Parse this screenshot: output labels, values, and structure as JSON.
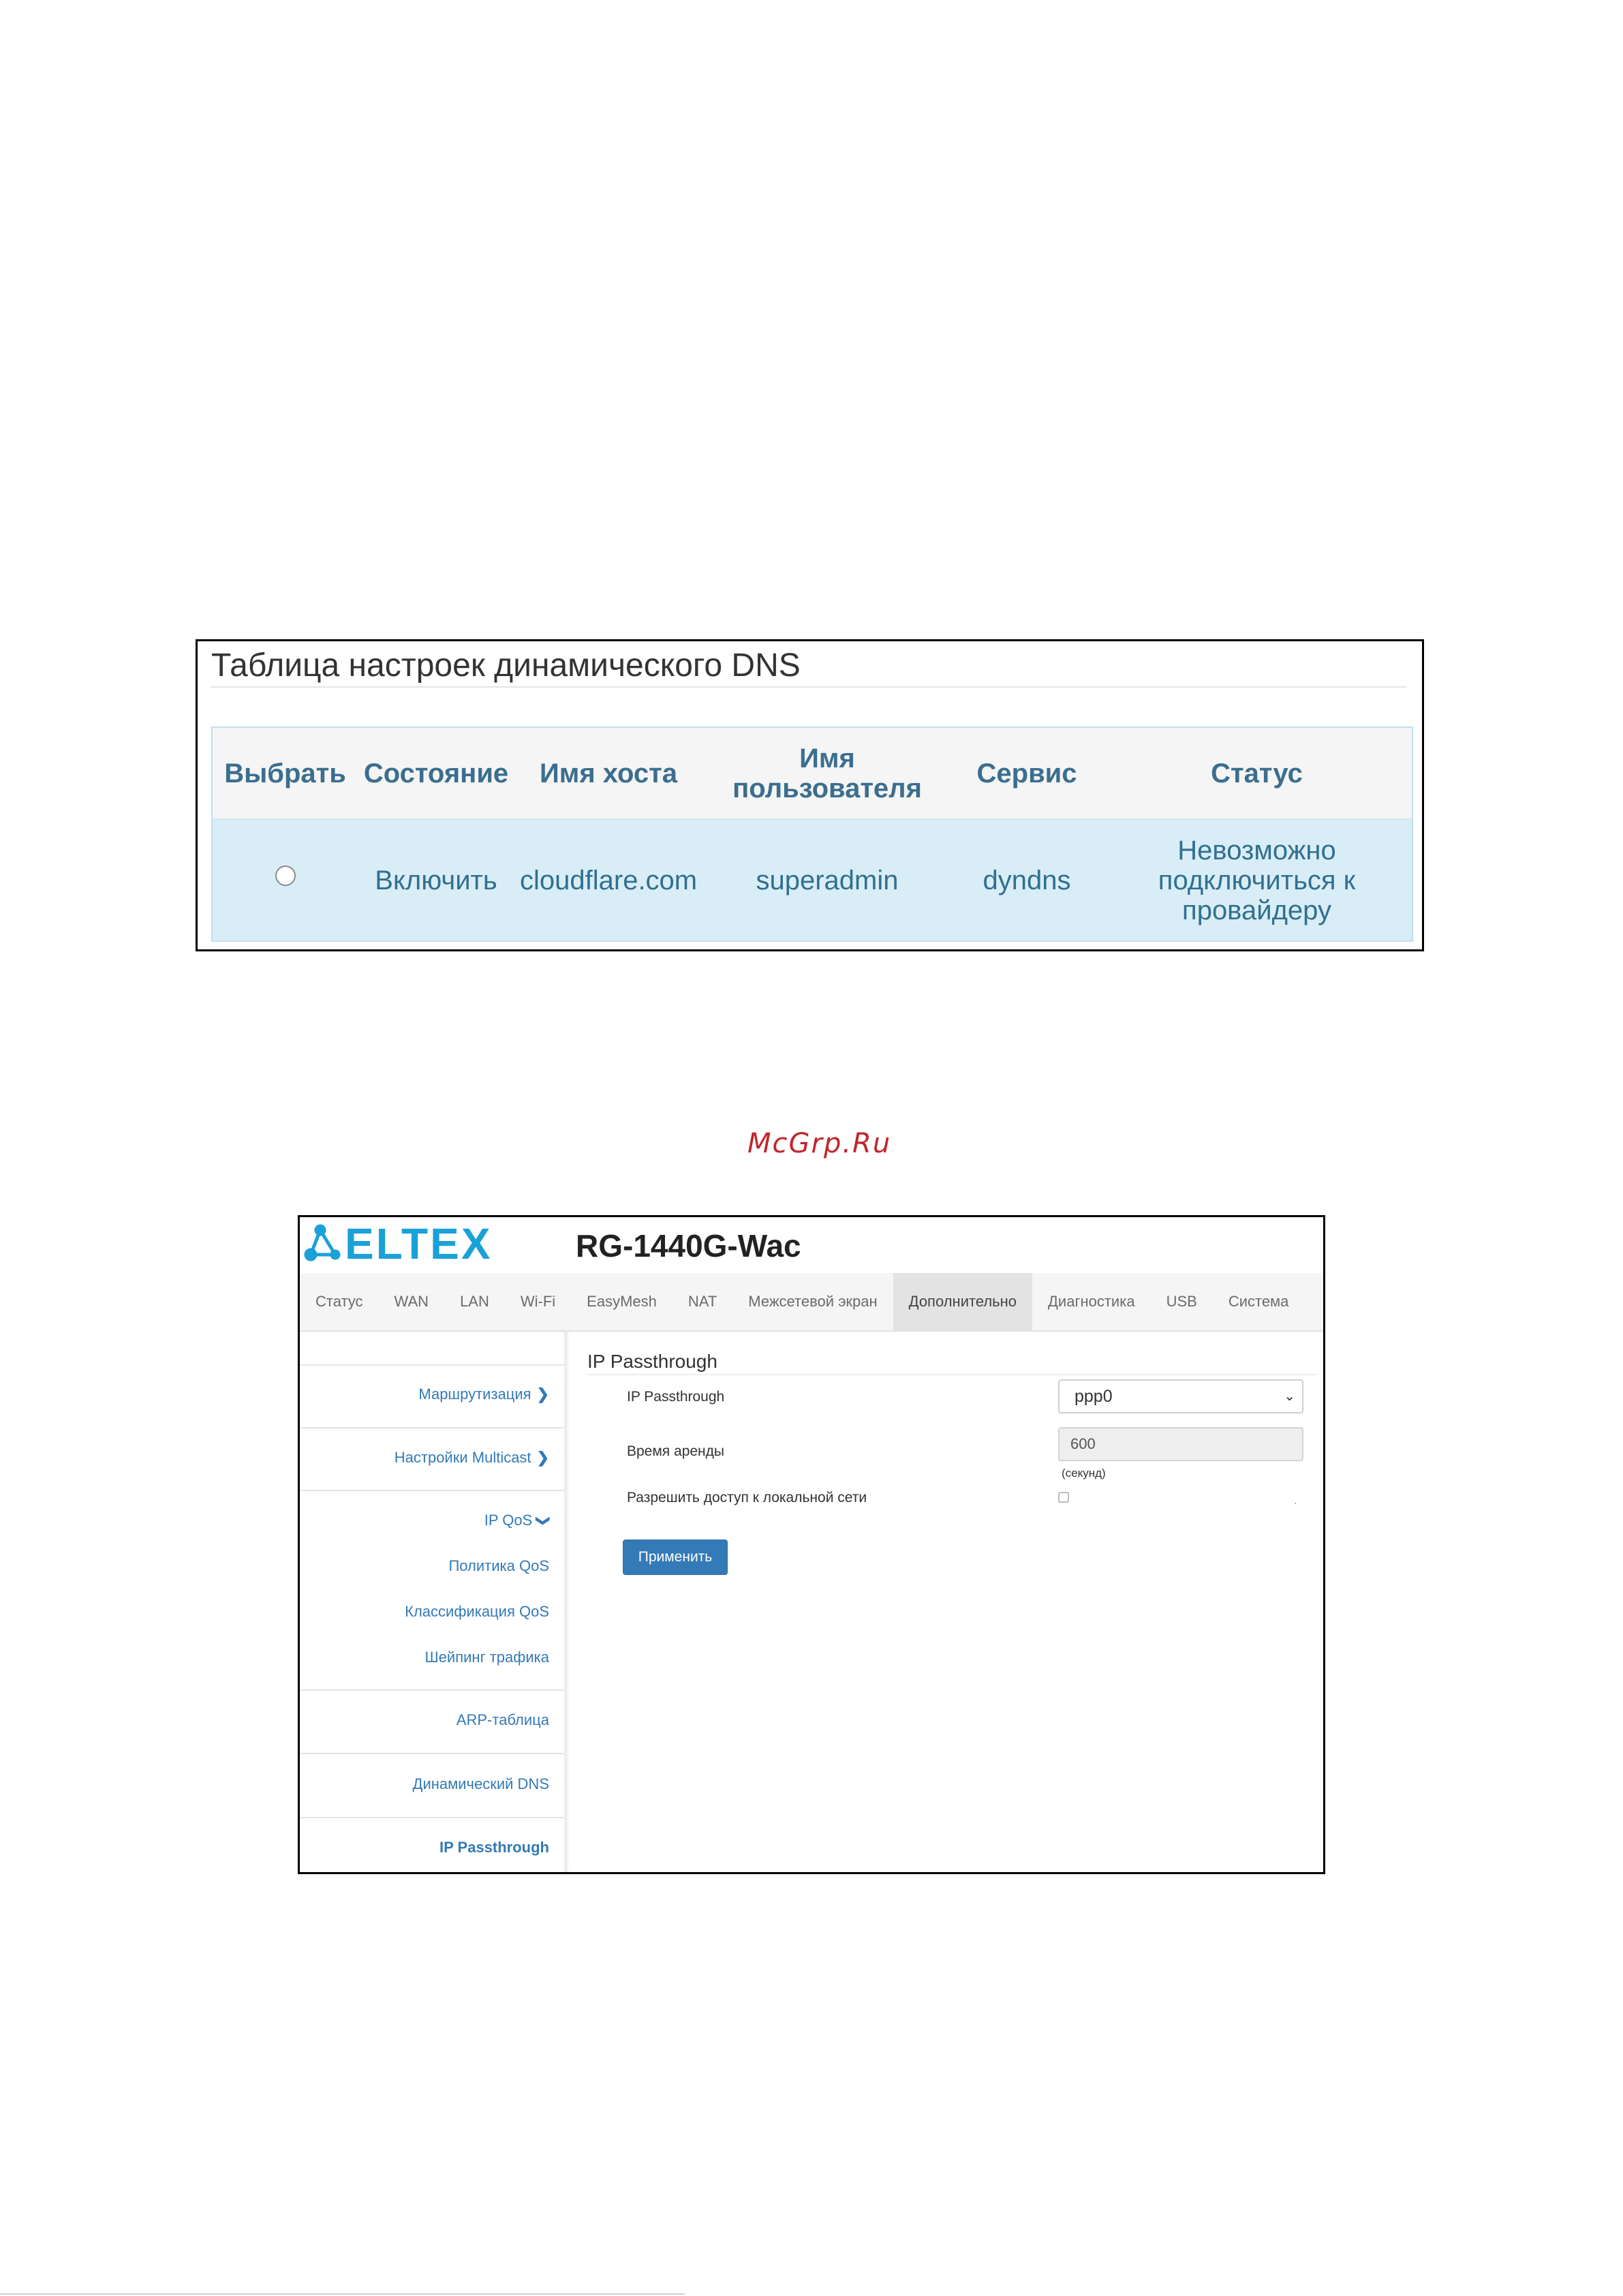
{
  "dns_table": {
    "title": "Таблица настроек динамического DNS",
    "headers": {
      "select": "Выбрать",
      "state": "Состояние",
      "hostname": "Имя хоста",
      "username_line1": "Имя",
      "username_line2": "пользователя",
      "service": "Сервис",
      "status": "Статус"
    },
    "row": {
      "state": "Включить",
      "hostname": "cloudflare.com",
      "username": "superadmin",
      "service": "dyndns",
      "status_line1": "Невозможно",
      "status_line2": "подключиться к",
      "status_line3": "провайдеру"
    }
  },
  "watermark": "McGrp.Ru",
  "router": {
    "logo_text": "ELTEX",
    "logo_icon": "eltex-network-logo-icon",
    "model": "RG-1440G-Wac",
    "nav_tabs": [
      {
        "label": "Статус"
      },
      {
        "label": "WAN"
      },
      {
        "label": "LAN"
      },
      {
        "label": "Wi-Fi"
      },
      {
        "label": "EasyMesh"
      },
      {
        "label": "NAT"
      },
      {
        "label": "Межсетевой экран"
      },
      {
        "label": "Дополнительно"
      },
      {
        "label": "Диагностика"
      },
      {
        "label": "USB"
      },
      {
        "label": "Система"
      }
    ],
    "active_tab": "Дополнительно",
    "sidebar": {
      "routing": "Маршрутизация",
      "multicast": "Настройки Multicast",
      "ipqos": "IP QoS",
      "qos_policy": "Политика QoS",
      "qos_class": "Классификация QoS",
      "traffic_shaping": "Шейпинг трафика",
      "arp": "ARP-таблица",
      "ddns": "Динамический DNS",
      "ippassthrough": "IP Passthrough"
    },
    "form": {
      "title": "IP Passthrough",
      "ipp_label": "IP Passthrough",
      "ipp_value": "ppp0",
      "lease_label": "Время аренды",
      "lease_value": "600",
      "lease_unit": "(секунд)",
      "lan_access_label": "Разрешить доступ к локальной сети",
      "lan_access_checked": false,
      "apply_button": "Применить"
    },
    "colors": {
      "brand_blue": "#1aa1d8",
      "link_blue": "#337ab7",
      "button_blue": "#337ab7"
    }
  }
}
